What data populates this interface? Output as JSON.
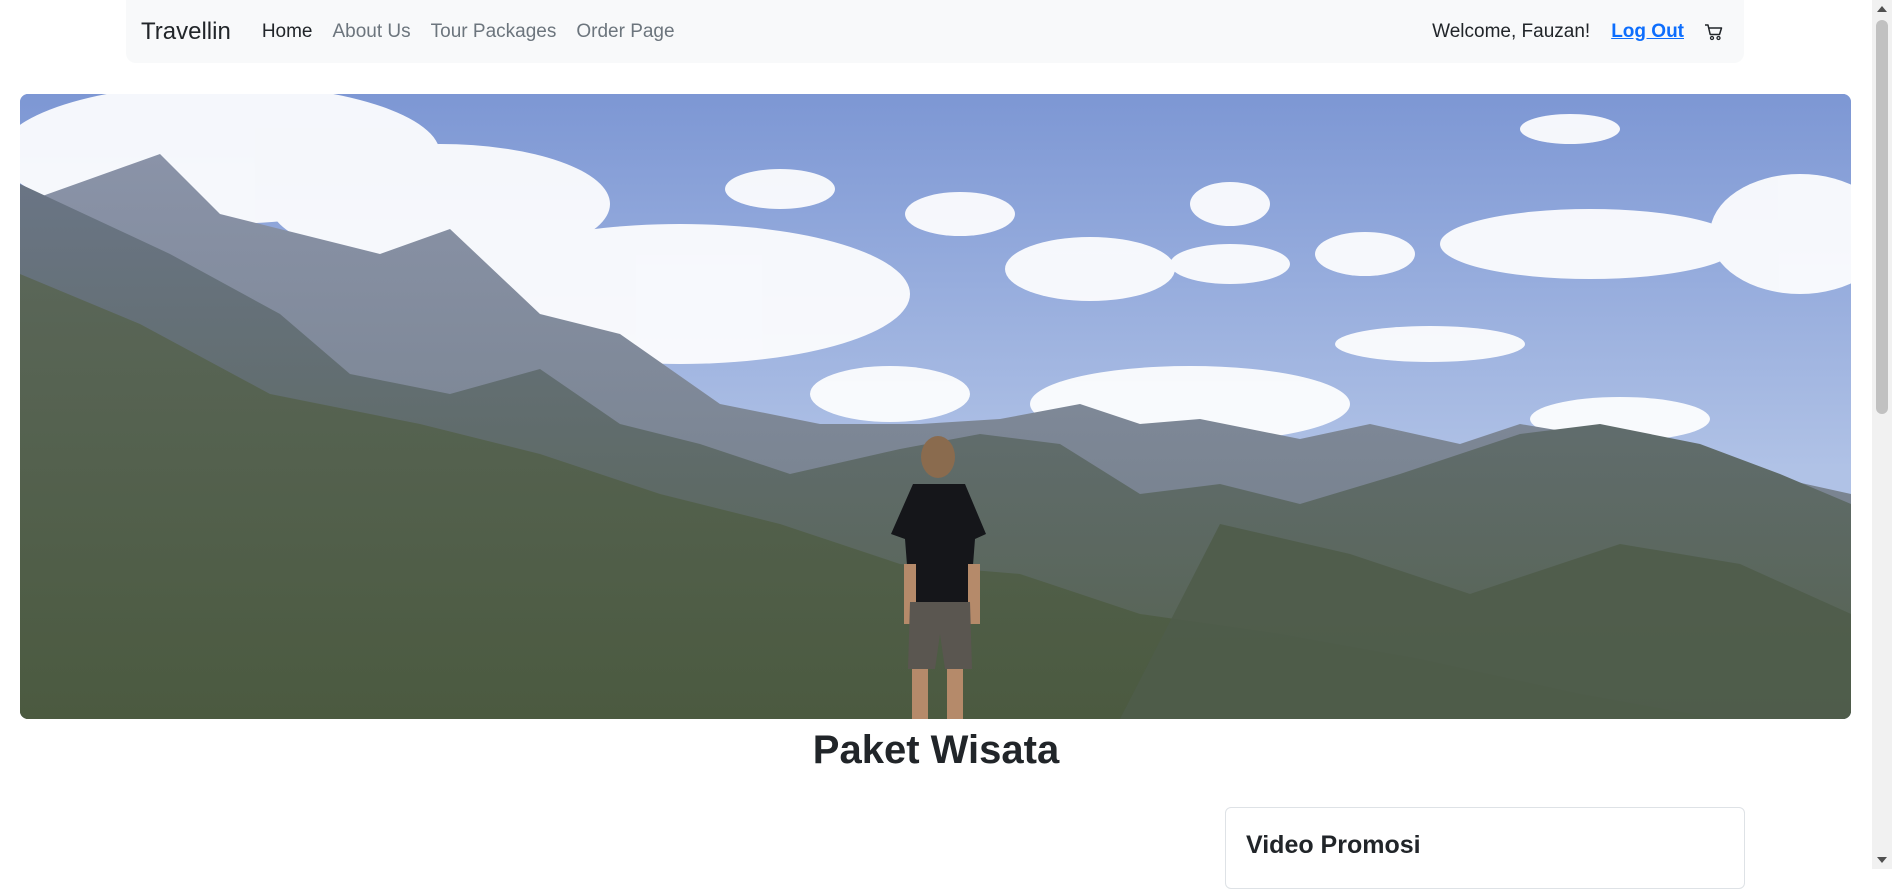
{
  "navbar": {
    "brand": "Travellin",
    "links": [
      {
        "label": "Home",
        "active": true
      },
      {
        "label": "About Us",
        "active": false
      },
      {
        "label": "Tour Packages",
        "active": false
      },
      {
        "label": "Order Page",
        "active": false
      }
    ],
    "welcome": "Welcome, Fauzan!",
    "logout": "Log Out",
    "cart_icon": "cart-icon"
  },
  "hero": {
    "image": "mountain-landscape-hiker"
  },
  "main": {
    "title": "Paket Wisata"
  },
  "card": {
    "title": "Video Promosi"
  },
  "colors": {
    "navbar_bg": "#f8f9fa",
    "link_active": "#212529",
    "link_muted": "#6c757d",
    "logout": "#0d6efd"
  }
}
